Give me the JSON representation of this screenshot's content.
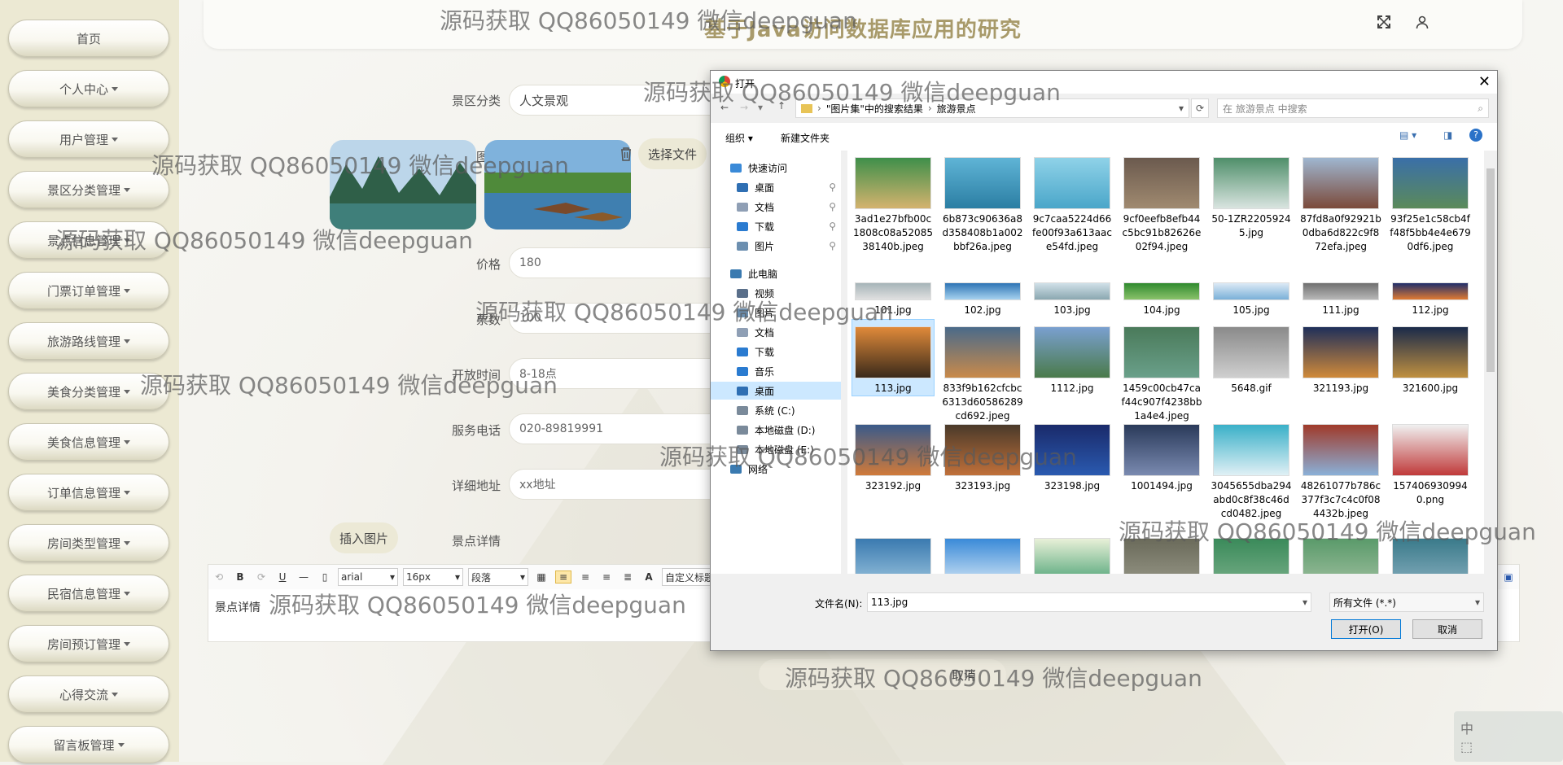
{
  "sidebar": {
    "items": [
      {
        "label": "首页",
        "caret": false
      },
      {
        "label": "个人中心",
        "caret": true
      },
      {
        "label": "用户管理",
        "caret": true
      },
      {
        "label": "景区分类管理",
        "caret": true
      },
      {
        "label": "景点信息管理",
        "caret": true
      },
      {
        "label": "门票订单管理",
        "caret": true
      },
      {
        "label": "旅游路线管理",
        "caret": true
      },
      {
        "label": "美食分类管理",
        "caret": true
      },
      {
        "label": "美食信息管理",
        "caret": true
      },
      {
        "label": "订单信息管理",
        "caret": true
      },
      {
        "label": "房间类型管理",
        "caret": true
      },
      {
        "label": "民宿信息管理",
        "caret": true
      },
      {
        "label": "房间预订管理",
        "caret": true
      },
      {
        "label": "心得交流",
        "caret": true
      },
      {
        "label": "留言板管理",
        "caret": true
      }
    ]
  },
  "header": {
    "title": "基于Java访问数据库应用的研究"
  },
  "form": {
    "category_label": "景区分类",
    "category_value": "人文景观",
    "image_label": "图片",
    "choose_file": "选择文件",
    "price_label": "价格",
    "price_value": "180",
    "tickets_label": "票数",
    "tickets_value": "100",
    "open_time_label": "开放时间",
    "open_time_value": "8-18点",
    "phone_label": "服务电话",
    "phone_value": "020-89819991",
    "address_label": "详细地址",
    "address_value": "xx地址",
    "detail_label": "景点详情",
    "insert_image": "插入图片",
    "editor_placeholder": "景点详情",
    "font_family": "arial",
    "font_size": "16px",
    "paragraph": "段落",
    "custom_title": "自定义标题",
    "cancel": "取消"
  },
  "dialog": {
    "title": "打开",
    "breadcrumb": [
      "\"图片集\"中的搜索结果",
      "旅游景点"
    ],
    "search_placeholder": "在 旅游景点 中搜索",
    "organize": "组织",
    "new_folder": "新建文件夹",
    "nav": {
      "quick_access": "快速访问",
      "quick": [
        {
          "label": "桌面",
          "color": "#2f6fb3"
        },
        {
          "label": "文档",
          "color": "#8f9fb5"
        },
        {
          "label": "下载",
          "color": "#2a7bd0"
        },
        {
          "label": "图片",
          "color": "#6c8fb0"
        }
      ],
      "this_pc": "此电脑",
      "pc": [
        {
          "label": "视频",
          "color": "#5a6f8a"
        },
        {
          "label": "图片",
          "color": "#6c8fb0"
        },
        {
          "label": "文档",
          "color": "#8f9fb5"
        },
        {
          "label": "下载",
          "color": "#2a7bd0"
        },
        {
          "label": "音乐",
          "color": "#2a7bd0"
        },
        {
          "label": "桌面",
          "color": "#2f6fb3"
        },
        {
          "label": "系统 (C:)",
          "color": "#7a8a9a"
        },
        {
          "label": "本地磁盘 (D:)",
          "color": "#7a8a9a"
        },
        {
          "label": "本地磁盘 (E:)",
          "color": "#7a8a9a"
        }
      ],
      "network": "网络"
    },
    "files": [
      {
        "name": "3ad1e27bfb00c1808c08a5208538140b.jpeg",
        "c1": "#3f8f4a",
        "c2": "#d4b36e"
      },
      {
        "name": "6b873c90636a8d358408b1a002bbf26a.jpeg",
        "c1": "#5fb4d6",
        "c2": "#2b7ea3"
      },
      {
        "name": "9c7caa5224d66fe00f93a613aace54fd.jpeg",
        "c1": "#8fd2e8",
        "c2": "#4aa6c9"
      },
      {
        "name": "9cf0eefb8efb44c5bc91b82626e02f94.jpeg",
        "c1": "#6b5a4e",
        "c2": "#a08a70"
      },
      {
        "name": "50-1ZR22059245.jpg",
        "c1": "#4f8f6a",
        "c2": "#d9e4e0"
      },
      {
        "name": "87fd8a0f92921b0dba6d822c9f872efa.jpeg",
        "c1": "#9fb6d0",
        "c2": "#7b4a3a"
      },
      {
        "name": "93f25e1c58cb4ff48f5bb4e4e6790df6.jpeg",
        "c1": "#3a6fa8",
        "c2": "#5b8a5a"
      },
      {
        "name": "101.jpg",
        "c1": "#a6b4b8",
        "c2": "#e0e0e0"
      },
      {
        "name": "102.jpg",
        "c1": "#2e74b5",
        "c2": "#a6d2ef"
      },
      {
        "name": "103.jpg",
        "c1": "#d0e0e8",
        "c2": "#8aa7b0"
      },
      {
        "name": "104.jpg",
        "c1": "#2f8a2f",
        "c2": "#8ac26a"
      },
      {
        "name": "105.jpg",
        "c1": "#dce9f5",
        "c2": "#7ab0d8"
      },
      {
        "name": "111.jpg",
        "c1": "#707070",
        "c2": "#b8b8b8"
      },
      {
        "name": "112.jpg",
        "c1": "#1f2e6a",
        "c2": "#e07b32"
      },
      {
        "name": "113.jpg",
        "c1": "#e08a3a",
        "c2": "#3a2a1a"
      },
      {
        "name": "833f9b162cfcbc6313d60586289cd692.jpeg",
        "c1": "#4a6a8a",
        "c2": "#c98a4a"
      },
      {
        "name": "1112.jpg",
        "c1": "#7aa0d0",
        "c2": "#4a7a4a"
      },
      {
        "name": "1459c00cb47caf44c907f4238bb1a4e4.jpeg",
        "c1": "#4a7a5a",
        "c2": "#6aa08a"
      },
      {
        "name": "5648.gif",
        "c1": "#8a8a8a",
        "c2": "#cfcfcf"
      },
      {
        "name": "321193.jpg",
        "c1": "#1f2f5a",
        "c2": "#d08a3a"
      },
      {
        "name": "321600.jpg",
        "c1": "#1a2a4a",
        "c2": "#c09040"
      },
      {
        "name": "323192.jpg",
        "c1": "#3a5a8a",
        "c2": "#d07a3a"
      },
      {
        "name": "323193.jpg",
        "c1": "#4a3a2a",
        "c2": "#c0703a"
      },
      {
        "name": "323198.jpg",
        "c1": "#1a2a6a",
        "c2": "#2a5ab0"
      },
      {
        "name": "1001494.jpg",
        "c1": "#2a3a5a",
        "c2": "#7a8ab0"
      },
      {
        "name": "3045655dba294abd0c8f38c46dcd0482.jpeg",
        "c1": "#3ab0c8",
        "c2": "#e0f0f5"
      },
      {
        "name": "48261077b786c377f3c7c4c0f084432b.jpeg",
        "c1": "#a03a2a",
        "c2": "#8ab0d8"
      },
      {
        "name": "1574069309940.png",
        "c1": "#f0f0f0",
        "c2": "#c03a3a"
      },
      {
        "name": "",
        "c1": "#3a7ab0",
        "c2": "#a0c8e0"
      },
      {
        "name": "",
        "c1": "#3a8ad8",
        "c2": "#e0eef8"
      },
      {
        "name": "",
        "c1": "#e8f0d8",
        "c2": "#3a9a6a"
      },
      {
        "name": "",
        "c1": "#6a6a5a",
        "c2": "#9a9a8a"
      },
      {
        "name": "",
        "c1": "#3a8a5a",
        "c2": "#7ab08a"
      },
      {
        "name": "",
        "c1": "#5a9a6a",
        "c2": "#a0c0a0"
      },
      {
        "name": "",
        "c1": "#3a7a8a",
        "c2": "#8ab0c0"
      }
    ],
    "filename_label": "文件名(N):",
    "filename_value": "113.jpg",
    "filetype_value": "所有文件 (*.*)",
    "open_button": "打开(O)",
    "cancel_button": "取消"
  },
  "watermark": "源码获取 QQ86050149 微信deepguan",
  "corner_widget": {
    "text": "中"
  }
}
